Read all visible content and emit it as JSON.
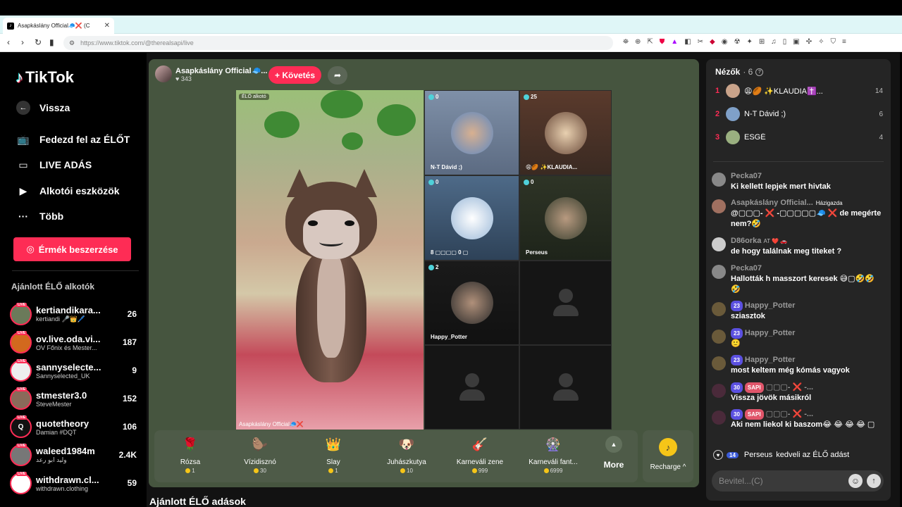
{
  "browser": {
    "tab_title": "Asapkáslány Official🧢❌ (C",
    "url": "https://www.tiktok.com/@therealsapi/live"
  },
  "sidebar": {
    "logo": "TikTok",
    "back": "Vissza",
    "nav": [
      "Fedezd fel az ÉLŐT",
      "LIVE ADÁS",
      "Alkotói eszközök",
      "Több"
    ],
    "coins_button": "Érmék beszerzése",
    "recommended_title": "Ajánlott ÉLŐ alkotók",
    "creators": [
      {
        "name": "kertiandikara...",
        "sub": "kertiandi 🎤👑🖊️",
        "count": "26"
      },
      {
        "name": "ov.live.oda.vi...",
        "sub": "OV Főnix és Mester...",
        "count": "187"
      },
      {
        "name": "sannyselecte...",
        "sub": "Sannyselected_UK",
        "count": "9"
      },
      {
        "name": "stmester3.0",
        "sub": "SteveMester",
        "count": "152"
      },
      {
        "name": "quotetheory",
        "sub": "Damian #DQT",
        "count": "106"
      },
      {
        "name": "waleed1984m",
        "sub": "وليد ابو رعد",
        "count": "2.4K"
      },
      {
        "name": "withdrawn.cl...",
        "sub": "withdrawn.clothing",
        "count": "59"
      }
    ]
  },
  "stream": {
    "host_name": "Asapkáslány Official🧢...",
    "host_likes": "343",
    "follow": "+ Követés",
    "main_tag": "ÉLŐ alkotó",
    "main_bottom": "Asapkáslány Official🧢❌",
    "guests": [
      {
        "badge": "0",
        "name": "N-T Dávid ;)"
      },
      {
        "badge": "25",
        "name": "😩🏉 ✨KLAUDIA..."
      },
      {
        "badge": "0",
        "name": "8 ▢▢▢▢ 0 ▢"
      },
      {
        "badge": "0",
        "name": "Perseus"
      },
      {
        "badge": "2",
        "name": "Happy_Potter"
      }
    ],
    "below_title": "Ajánlott ÉLŐ adások"
  },
  "gifts": [
    {
      "name": "Rózsa",
      "price": "1",
      "icon": "🌹"
    },
    {
      "name": "Vízidisznó",
      "price": "30",
      "icon": "🦫"
    },
    {
      "name": "Slay",
      "price": "1",
      "icon": "👑"
    },
    {
      "name": "Juhászkutya",
      "price": "10",
      "icon": "🐶"
    },
    {
      "name": "Karneváli zene",
      "price": "999",
      "icon": "🎸"
    },
    {
      "name": "Karneváli fant...",
      "price": "6999",
      "icon": "🎡"
    }
  ],
  "gift_more": "More",
  "recharge": "Recharge ^",
  "chat": {
    "viewers_label": "Nézők",
    "viewers_count": "· 6",
    "ranking": [
      {
        "rank": "1",
        "name": "😩🏉 ✨KLAUDIA✝️...",
        "count": "14"
      },
      {
        "rank": "2",
        "name": "N-T Dávid ;)",
        "count": "6"
      },
      {
        "rank": "3",
        "name": "ESGÉ",
        "count": "4"
      }
    ],
    "messages": [
      {
        "user": "Pecka07",
        "text": "Ki kellett lepjek mert hivtak"
      },
      {
        "user": "Asapkáslány Official...",
        "tag": "Házigazda",
        "text": "@▢▢▢- ❌ -▢▢▢▢▢🧢 ❌ de megérte nem?🤣"
      },
      {
        "user": "D86orka",
        "tag": "AT ❤️ 🚗",
        "text": "de hogy találnak meg titeket ?"
      },
      {
        "user": "Pecka07",
        "text": "Hallották h masszort keresek 😅▢🤣🤣 🤣"
      },
      {
        "user": "Happy_Potter",
        "lvl": "23",
        "text": "sziasztok"
      },
      {
        "user": "Happy_Potter",
        "lvl": "23",
        "text": "🙂"
      },
      {
        "user": "Happy_Potter",
        "lvl": "23",
        "text": "most keltem még kómás vagyok"
      },
      {
        "user": "▢▢▢- ❌ -...",
        "lvl": "30",
        "fan": "SAPI",
        "text": "Vissza jövök másikról"
      },
      {
        "user": "▢▢▢- ❌ -...",
        "lvl": "30",
        "fan": "SAPI",
        "text": "Aki nem liekol ki baszom😂 😂 😂 😂 ▢"
      }
    ],
    "like_lvl": "14",
    "like_user": "Perseus",
    "like_text": "kedveli az ÉLŐ adást",
    "input_placeholder": "Bevitel...(C)"
  }
}
